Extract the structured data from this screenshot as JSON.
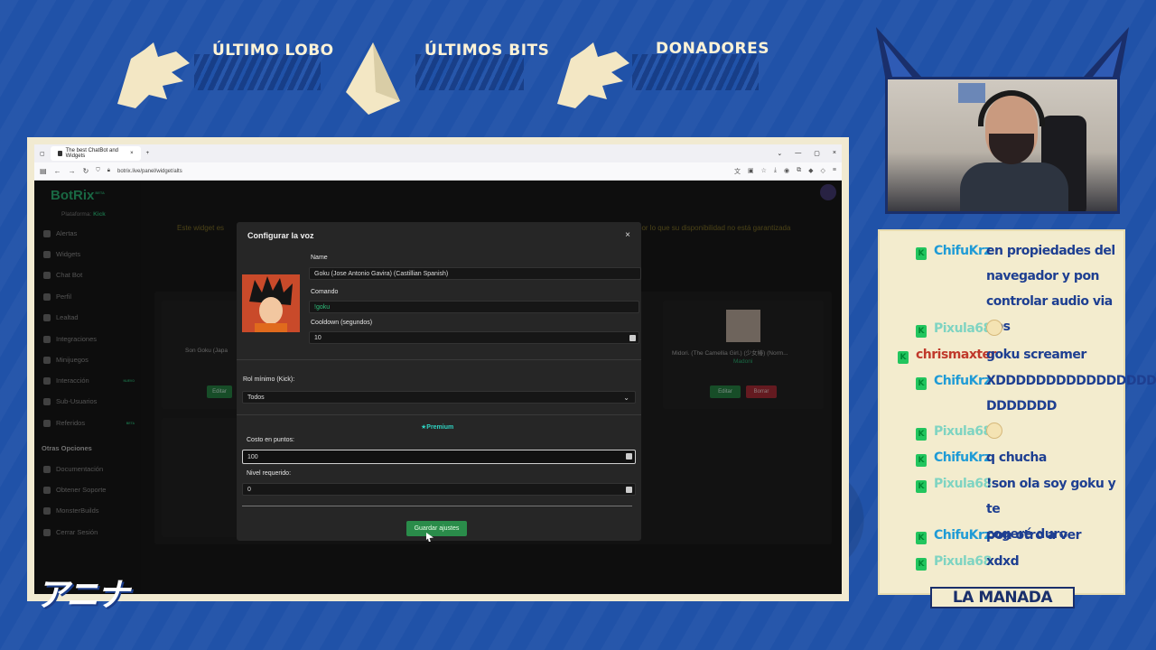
{
  "banner": {
    "ultimo_lobo": "ÚLTIMO LOBO",
    "ultimos_bits": "ÚLTIMOS BITS",
    "donadores": "DONADORES"
  },
  "browser": {
    "tab_title": "The best ChatBot and Widgets",
    "url": "botrix.live/panel/widget/alts"
  },
  "app": {
    "logo": "BotRix",
    "logo_tag": "BETA",
    "platform_label": "Plataforma:",
    "platform_value": "Kick",
    "nav": [
      {
        "label": "Alertas"
      },
      {
        "label": "Widgets"
      },
      {
        "label": "Chat Bot"
      },
      {
        "label": "Perfil"
      },
      {
        "label": "Lealtad"
      },
      {
        "label": "Integraciones"
      },
      {
        "label": "Minijuegos"
      },
      {
        "label": "Interacción",
        "tag": "NUEVO"
      },
      {
        "label": "Sub-Usuarios"
      },
      {
        "label": "Referidos",
        "tag": "BETA"
      }
    ],
    "section_other": "Otras Opciones",
    "other_nav": [
      {
        "label": "Documentación"
      },
      {
        "label": "Obtener Soporte"
      },
      {
        "label": "MonsterBuilds"
      },
      {
        "label": "Cerrar Sesión"
      }
    ],
    "warning_left": "Este widget es",
    "warning_right": "por lo que su disponibilidad no está garantizada",
    "cards": [
      {
        "name": "Son Goku (Japa",
        "edit": "Editar"
      },
      {
        "name": "Midori. (The Camellia Girl.) (少女椿) (Norm...",
        "sub": "Madoni",
        "edit": "Editar",
        "delete": "Borrar"
      }
    ]
  },
  "modal": {
    "title": "Configurar la voz",
    "close": "×",
    "name_label": "Name",
    "name_value": "Goku (Jose Antonio Gavira) (Castillian Spanish)",
    "command_label": "Comando",
    "command_value": "!goku",
    "cooldown_label": "Cooldown (segundos)",
    "cooldown_value": "10",
    "role_label": "Rol mínimo (Kick):",
    "role_value": "Todos",
    "premium": "★Premium",
    "cost_label": "Costo en puntos:",
    "cost_value": "100",
    "level_label": "Nivel requerido:",
    "level_value": "0",
    "save": "Guardar ajustes"
  },
  "anime_logo": "アニナ",
  "chat": {
    "messages": [
      {
        "user": "ChifuKrz",
        "color": "#1f9bd6",
        "lines": [
          "en propiedades del",
          "navegador y pon",
          "controlar audio via obs"
        ]
      },
      {
        "user": "Pixula68",
        "color": "#7fd4c2",
        "lines": [
          ""
        ],
        "emote": true
      },
      {
        "user": "chrismaxter",
        "color": "#c0392b",
        "lines": [
          "goku screamer"
        ]
      },
      {
        "user": "ChifuKrz",
        "color": "#1f9bd6",
        "lines": [
          "XDDDDDDDDDDDDDDDD",
          "DDDDDDD"
        ]
      },
      {
        "user": "Pixula68",
        "color": "#7fd4c2",
        "lines": [
          ""
        ],
        "emote": true
      },
      {
        "user": "ChifuKrz",
        "color": "#1f9bd6",
        "lines": [
          "q chucha"
        ]
      },
      {
        "user": "Pixula68",
        "color": "#7fd4c2",
        "lines": [
          "!son ola soy goku y te",
          "cogeré duro"
        ]
      },
      {
        "user": "ChifuKrz",
        "color": "#1f9bd6",
        "lines": [
          "pon otro a ver"
        ]
      },
      {
        "user": "Pixula68",
        "color": "#7fd4c2",
        "lines": [
          "xdxd"
        ]
      }
    ],
    "footer": "LA MANADA"
  }
}
